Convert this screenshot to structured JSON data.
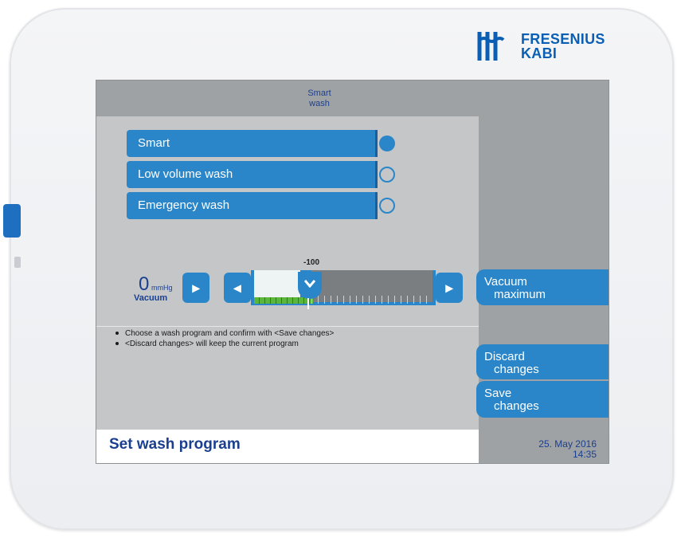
{
  "brand": {
    "line1": "FRESENIUS",
    "line2": "KABI",
    "color": "#0a5fb4"
  },
  "titlebar": {
    "line1": "Smart",
    "line2": "wash"
  },
  "programs": [
    {
      "label": "Smart",
      "selected": true
    },
    {
      "label": "Low volume wash",
      "selected": false
    },
    {
      "label": "Emergency wash",
      "selected": false
    }
  ],
  "vacuum": {
    "value": "0",
    "unit": "mmHg",
    "label": "Vacuum",
    "scale_label": "-100"
  },
  "hints": [
    "Choose a wash program and confirm with <Save changes>",
    "<Discard changes> will keep the current program"
  ],
  "buttons": {
    "vacuum_max": {
      "line1": "Vacuum",
      "line2": "maximum"
    },
    "discard": {
      "line1": "Discard",
      "line2": "changes"
    },
    "save": {
      "line1": "Save",
      "line2": "changes"
    }
  },
  "footer": {
    "title": "Set wash program",
    "date": "25. May 2016",
    "time": "14:35"
  },
  "icons": {
    "arrow_right": "▸",
    "arrow_left": "◂",
    "slider_handle": "chevron-down-icon"
  },
  "colors": {
    "accent": "#2a86c8",
    "text_blue": "#1b3f8f",
    "screen_bg": "#c4c6c8"
  }
}
